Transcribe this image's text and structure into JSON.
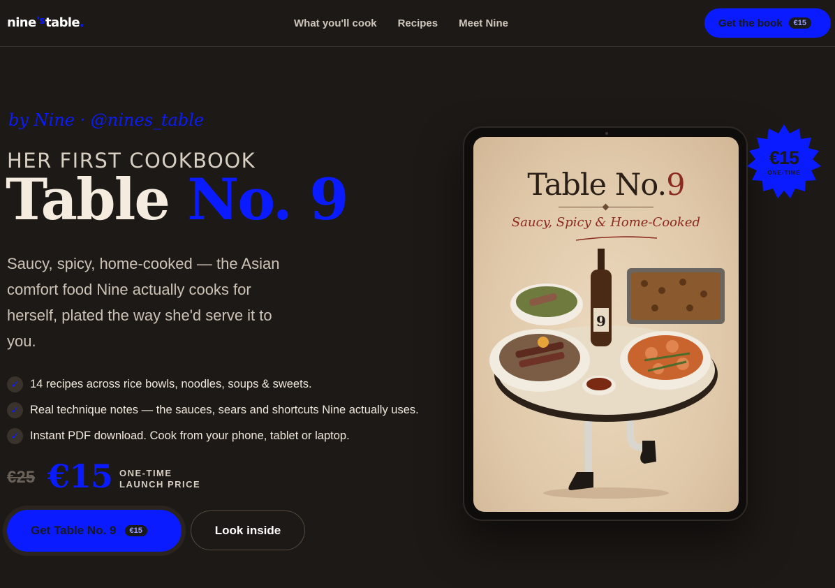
{
  "nav": {
    "logo_main": "nine",
    "logo_apos": "'s",
    "logo_end": "table",
    "logo_dot": ".",
    "links": [
      "What you'll cook",
      "Recipes",
      "Meet Nine"
    ],
    "cta_label": "Get the book",
    "cta_price": "€15"
  },
  "hero": {
    "byline": "by Nine · @nines_table",
    "kicker": "HER FIRST COOKBOOK",
    "title_plain": "Table",
    "title_accent": "No. 9",
    "lede": "Saucy, spicy, home-cooked — the Asian comfort food Nine actually cooks for herself, plated the way she'd serve it to you.",
    "features": [
      "14 recipes across rice bowls, noodles, soups & sweets.",
      "Real technique notes — the sauces, sears and shortcuts Nine actually uses.",
      "Instant PDF download. Cook from your phone, tablet or laptop."
    ],
    "check_glyph": "✓",
    "price_old": "€25",
    "price_new": "€15",
    "price_note_line1": "ONE-TIME",
    "price_note_line2": "LAUNCH PRICE",
    "primary_label": "Get Table No. 9",
    "primary_price": "€15",
    "secondary_label": "Look inside"
  },
  "cover": {
    "title_plain": "Table No.",
    "title_accent": "9",
    "subtitle": "Saucy, Spicy & Home-Cooked",
    "bottle_label": "9"
  },
  "badge": {
    "price": "€15",
    "note": "ONE-TIME"
  },
  "colors": {
    "accent": "#0a1bff",
    "background": "#1d1916",
    "cover_red": "#8b2a1e"
  }
}
